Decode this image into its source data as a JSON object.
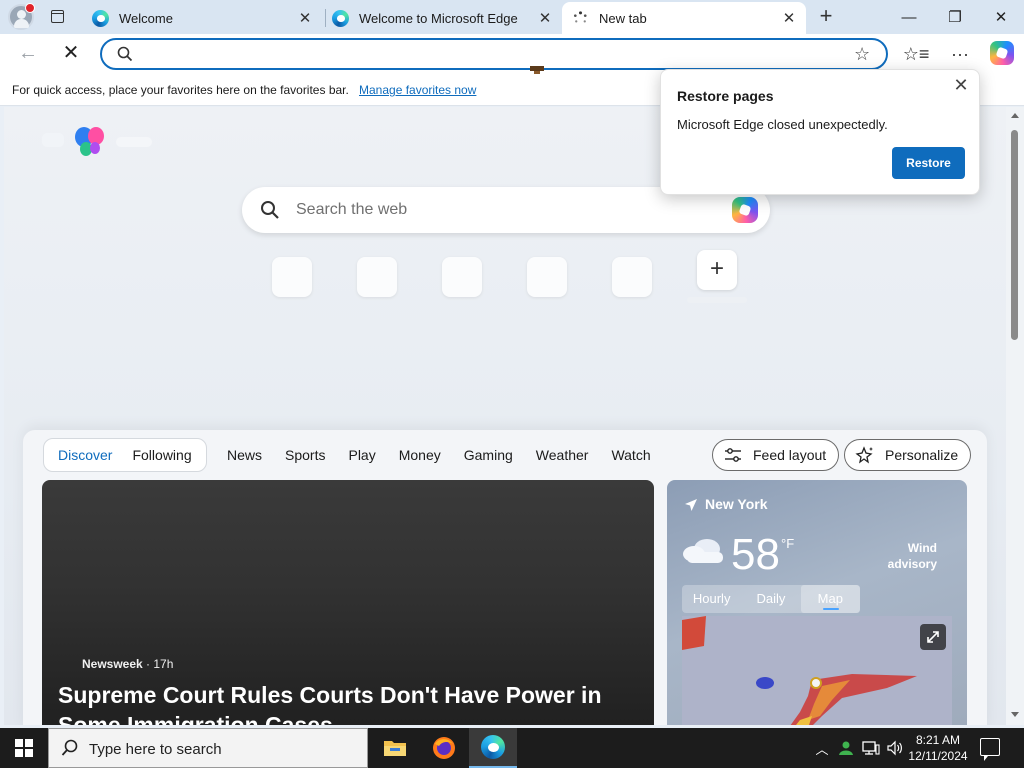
{
  "tabs": [
    {
      "title": "Welcome",
      "close": "✕",
      "active": false
    },
    {
      "title": "Welcome to Microsoft Edge",
      "close": "✕",
      "active": false
    },
    {
      "title": "New tab",
      "close": "✕",
      "active": true
    }
  ],
  "tab_strip": {
    "new_tab_symbol": "+"
  },
  "window_controls": {
    "minimize": "—",
    "restore": "❐",
    "close": "✕"
  },
  "toolbar": {
    "back_symbol": "←",
    "stop_symbol": "✕",
    "address_value": "",
    "favorite_symbol": "☆",
    "favorites_symbol": "☆≡",
    "more_symbol": "···"
  },
  "favorites_bar": {
    "hint": "For quick access, place your favorites here on the favorites bar.",
    "link": "Manage favorites now"
  },
  "ntp": {
    "search_placeholder": "Search the web",
    "add_symbol": "+"
  },
  "feed": {
    "toggle": [
      "Discover",
      "Following"
    ],
    "nav": [
      "News",
      "Sports",
      "Play",
      "Money",
      "Gaming",
      "Weather",
      "Watch"
    ],
    "feed_layout_label": "Feed layout",
    "personalize_label": "Personalize",
    "hero": {
      "source": "Newsweek",
      "age": "· 17h",
      "headline": "Supreme Court Rules Courts Don't Have Power in Some Immigration Cases"
    },
    "weather": {
      "city": "New York",
      "temp": "58",
      "unit": "°F",
      "advisory": "Wind advisory",
      "tabs": [
        "Hourly",
        "Daily",
        "Map"
      ],
      "selected_tab": "Map"
    }
  },
  "restore_popup": {
    "title": "Restore pages",
    "message": "Microsoft Edge closed unexpectedly.",
    "button": "Restore",
    "close": "✕"
  },
  "taskbar": {
    "search_placeholder": "Type here to search",
    "time": "8:21 AM",
    "date": "12/11/2024",
    "tray_symbols": {
      "chevron": "︿",
      "speaker": "🔈"
    }
  },
  "colors": {
    "accent": "#0f6cbd",
    "tab_strip": "#d9e5f2",
    "taskbar": "#1c1c1c"
  }
}
